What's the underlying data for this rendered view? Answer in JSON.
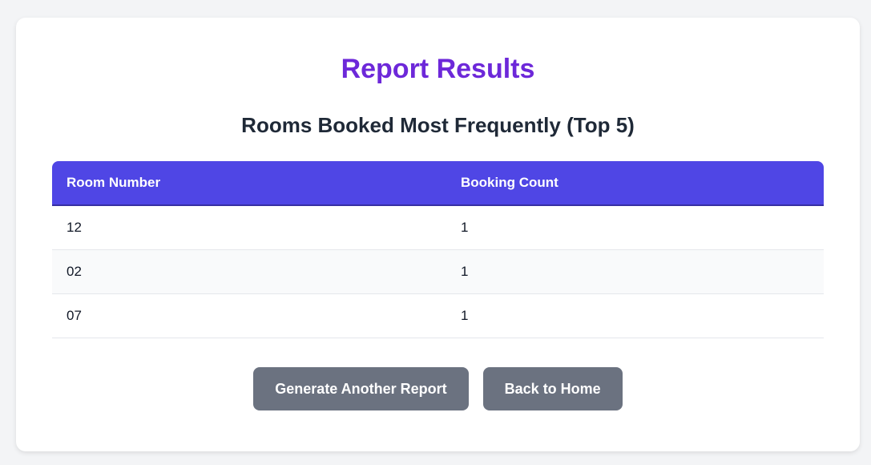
{
  "page": {
    "title": "Report Results",
    "report_heading": "Rooms Booked Most Frequently (Top 5)"
  },
  "table": {
    "columns": [
      "Room Number",
      "Booking Count"
    ],
    "rows": [
      {
        "room": "12",
        "count": "1"
      },
      {
        "room": "02",
        "count": "1"
      },
      {
        "room": "07",
        "count": "1"
      }
    ]
  },
  "actions": {
    "generate_label": "Generate Another Report",
    "home_label": "Back to Home"
  },
  "colors": {
    "title": "#6d28d9",
    "table_header": "#4f46e5",
    "button": "#6b7280"
  }
}
